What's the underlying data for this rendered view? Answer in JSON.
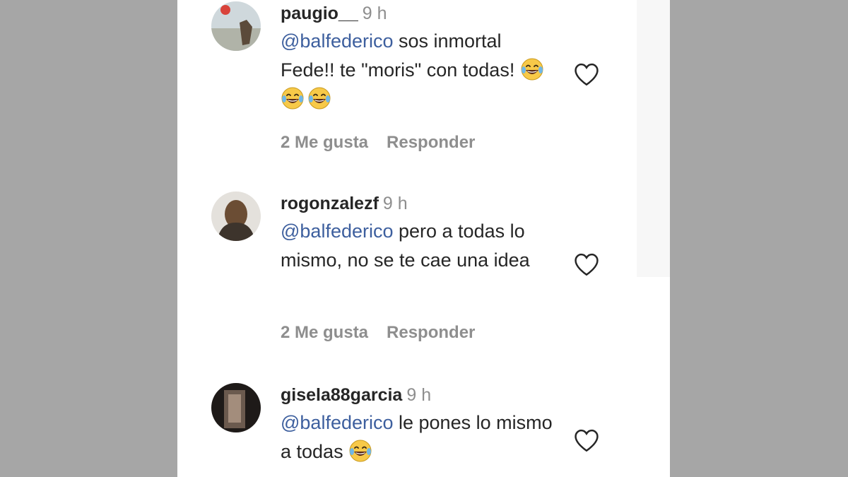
{
  "comments": [
    {
      "username": "paugio__",
      "time": "9 h",
      "mention": "@balfederico",
      "text_after_mention": " sos inmortal Fede!! te \"moris\" con todas! ",
      "emoji": [
        "laughing-crying-emoji",
        "laughing-crying-emoji",
        "laughing-crying-emoji"
      ],
      "likes_label": "2 Me gusta",
      "reply_label": "Responder"
    },
    {
      "username": "rogonzalezf",
      "time": "9 h",
      "mention": "@balfederico",
      "text_after_mention": " pero a todas lo mismo, no se te cae una idea",
      "emoji": [],
      "likes_label": "2 Me gusta",
      "reply_label": "Responder"
    },
    {
      "username": "gisela88garcia",
      "time": "9 h",
      "mention": "@balfederico",
      "text_after_mention": " le pones lo mismo a todas ",
      "emoji": [
        "laughing-crying-emoji"
      ],
      "likes_label": "",
      "reply_label": ""
    }
  ],
  "colors": {
    "mention": "#3d5f9e",
    "text": "#262626",
    "secondary": "#8e8e8e",
    "background": "#a6a6a6"
  },
  "icons": {
    "like": "heart-outline-icon"
  }
}
